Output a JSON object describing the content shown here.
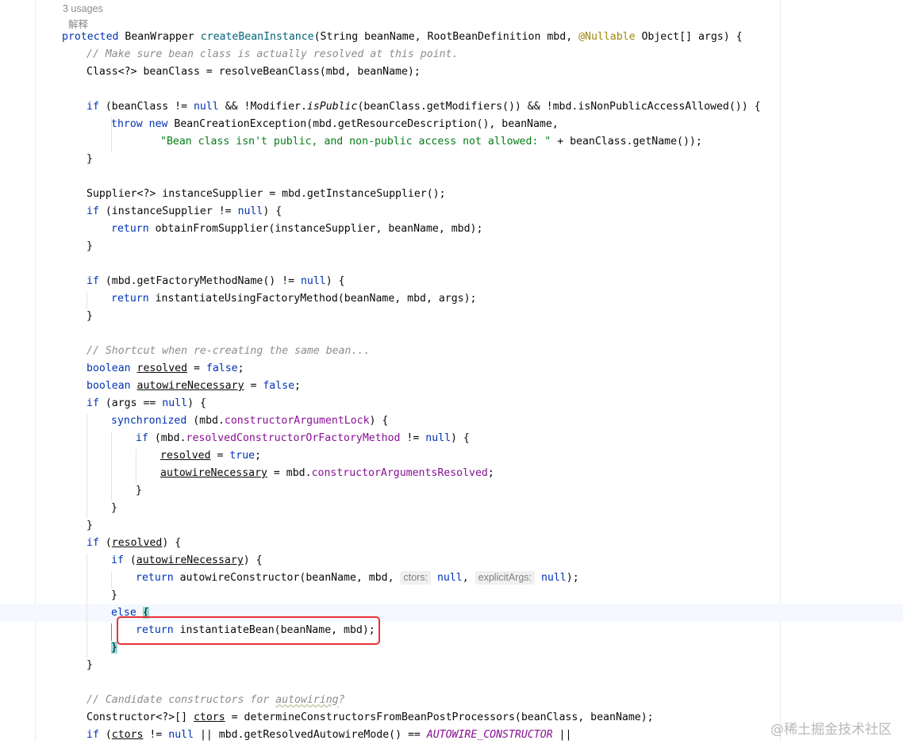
{
  "header": {
    "usages": "3 usages",
    "explain": "解释"
  },
  "watermark": "@稀土掘金技术社区",
  "code": {
    "l1": {
      "mod": "protected",
      "type": " BeanWrapper ",
      "method": "createBeanInstance",
      "params_a": "(String beanName, RootBeanDefinition mbd, ",
      "annotation": "@Nullable",
      "params_b": " Object[] args) {"
    },
    "l2": "// Make sure bean class is actually resolved at this point.",
    "l3": "Class<?> beanClass = resolveBeanClass(mbd, beanName);",
    "l5": {
      "kw_if": "if",
      "a": " (beanClass != ",
      "kw_null": "null",
      "b": " && !Modifier.",
      "method": "isPublic",
      "c": "(beanClass.getModifiers()) && !mbd.isNonPublicAccessAllowed()) {"
    },
    "l6": {
      "kw_throw": "throw",
      "kw_new": "new",
      "rest": " BeanCreationException(mbd.getResourceDescription(), beanName,"
    },
    "l7": {
      "str": "\"Bean class isn't public, and non-public access not allowed: \"",
      "rest": " + beanClass.getName());"
    },
    "l8": "}",
    "l10": "Supplier<?> instanceSupplier = mbd.getInstanceSupplier();",
    "l11": {
      "kw_if": "if",
      "a": " (instanceSupplier != ",
      "kw_null": "null",
      "b": ") {"
    },
    "l12": {
      "kw_return": "return",
      "rest": " obtainFromSupplier(instanceSupplier, beanName, mbd);"
    },
    "l13": "}",
    "l15": {
      "kw_if": "if",
      "a": " (mbd.getFactoryMethodName() != ",
      "kw_null": "null",
      "b": ") {"
    },
    "l16": {
      "kw_return": "return",
      "rest": " instantiateUsingFactoryMethod(beanName, mbd, args);"
    },
    "l17": "}",
    "l19": "// Shortcut when re-creating the same bean...",
    "l20": {
      "kw": "boolean",
      "var": "resolved",
      "eq": " = ",
      "val": "false",
      "end": ";"
    },
    "l21": {
      "kw": "boolean",
      "var": "autowireNecessary",
      "eq": " = ",
      "val": "false",
      "end": ";"
    },
    "l22": {
      "kw_if": "if",
      "a": " (args == ",
      "kw_null": "null",
      "b": ") {"
    },
    "l23": {
      "kw": "synchronized",
      "a": " (mbd.",
      "field": "constructorArgumentLock",
      "b": ") {"
    },
    "l24": {
      "kw_if": "if",
      "a": " (mbd.",
      "field": "resolvedConstructorOrFactoryMethod",
      "b": " != ",
      "kw_null": "null",
      "c": ") {"
    },
    "l25": {
      "var": "resolved",
      "eq": " = ",
      "val": "true",
      "end": ";"
    },
    "l26": {
      "var": "autowireNecessary",
      "eq": " = mbd.",
      "field": "constructorArgumentsResolved",
      "end": ";"
    },
    "l27": "}",
    "l28": "}",
    "l29": "}",
    "l30": {
      "kw_if": "if",
      "a": " (",
      "var": "resolved",
      "b": ") {"
    },
    "l31": {
      "kw_if": "if",
      "a": " (",
      "var": "autowireNecessary",
      "b": ") {"
    },
    "l32": {
      "kw_return": "return",
      "a": " autowireConstructor(beanName, mbd, ",
      "hint1": "ctors:",
      "null1": "null",
      "comma": ", ",
      "hint2": "explicitArgs:",
      "null2": "null",
      "end": ");"
    },
    "l33": "}",
    "l34": {
      "kw_else": "else",
      "brace": "{"
    },
    "l35": {
      "kw_return": "return",
      "rest": " instantiateBean(beanName, mbd);"
    },
    "l36": "}",
    "l37": "}",
    "l39": {
      "a": "// Candidate constructors for ",
      "b": "autowiring",
      "c": "?"
    },
    "l40": {
      "a": "Constructor<?>[] ",
      "var": "ctors",
      "b": " = determineConstructorsFromBeanPostProcessors(beanClass, beanName);"
    },
    "l41": {
      "kw_if": "if",
      "a": " (",
      "var": "ctors",
      "b": " != ",
      "kw_null": "null",
      "c": " || mbd.getResolvedAutowireMode() == ",
      "const": "AUTOWIRE_CONSTRUCTOR",
      "d": " ||"
    }
  }
}
